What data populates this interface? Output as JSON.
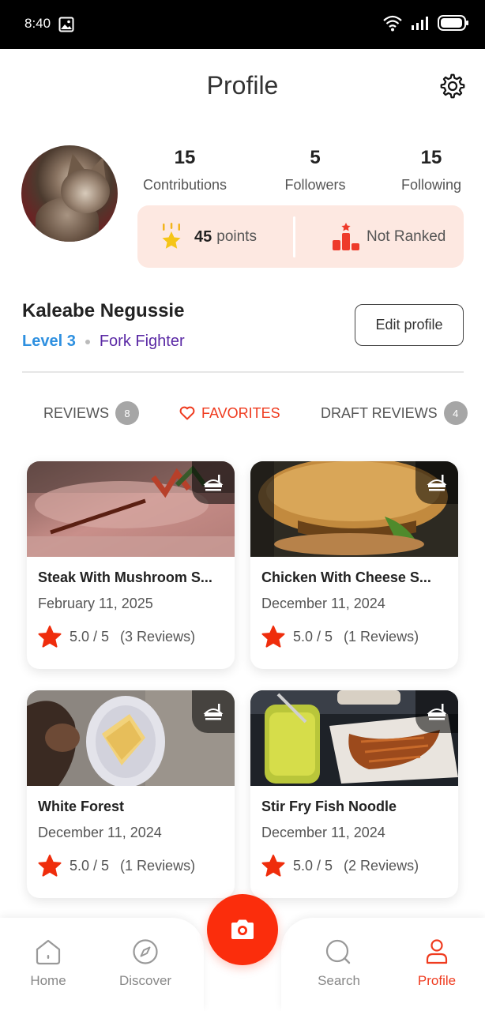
{
  "status_bar": {
    "time": "8:40"
  },
  "header": {
    "title": "Profile"
  },
  "profile": {
    "stats": [
      {
        "value": "15",
        "label": "Contributions"
      },
      {
        "value": "5",
        "label": "Followers"
      },
      {
        "value": "15",
        "label": "Following"
      }
    ],
    "points": {
      "value": "45",
      "unit": "points"
    },
    "rank": "Not Ranked",
    "name": "Kaleabe Negussie",
    "level": "Level 3",
    "title": "Fork Fighter",
    "edit_label": "Edit profile"
  },
  "tabs": [
    {
      "label": "REVIEWS",
      "badge": "8"
    },
    {
      "label": "FAVORITES"
    },
    {
      "label": "DRAFT REVIEWS",
      "badge": "4"
    }
  ],
  "cards": [
    {
      "title": "Steak With Mushroom S...",
      "date": "February 11, 2025",
      "rating": "5.0 / 5",
      "reviews": "(3 Reviews)"
    },
    {
      "title": "Chicken With Cheese S...",
      "date": "December 11, 2024",
      "rating": "5.0 / 5",
      "reviews": "(1 Reviews)"
    },
    {
      "title": "White Forest",
      "date": "December 11, 2024",
      "rating": "5.0 / 5",
      "reviews": "(1 Reviews)"
    },
    {
      "title": "Stir Fry Fish Noodle",
      "date": "December 11, 2024",
      "rating": "5.0 / 5",
      "reviews": "(2 Reviews)"
    }
  ],
  "nav": {
    "home": "Home",
    "discover": "Discover",
    "search": "Search",
    "profile": "Profile"
  },
  "colors": {
    "accent": "#fb2d0c",
    "favorites_active": "#ef3b1f",
    "level_blue": "#2e90e0",
    "title_purple": "#5b2aa5",
    "points_bg": "#fde8e1",
    "star": "#ef2d0c"
  },
  "icons": [
    "image-icon",
    "wifi-icon",
    "signal-icon",
    "battery-icon",
    "gear-icon",
    "trophy-star-icon",
    "podium-icon",
    "heart-icon",
    "tray-icon",
    "star-icon",
    "home-icon",
    "compass-icon",
    "camera-icon",
    "search-icon",
    "user-icon"
  ]
}
